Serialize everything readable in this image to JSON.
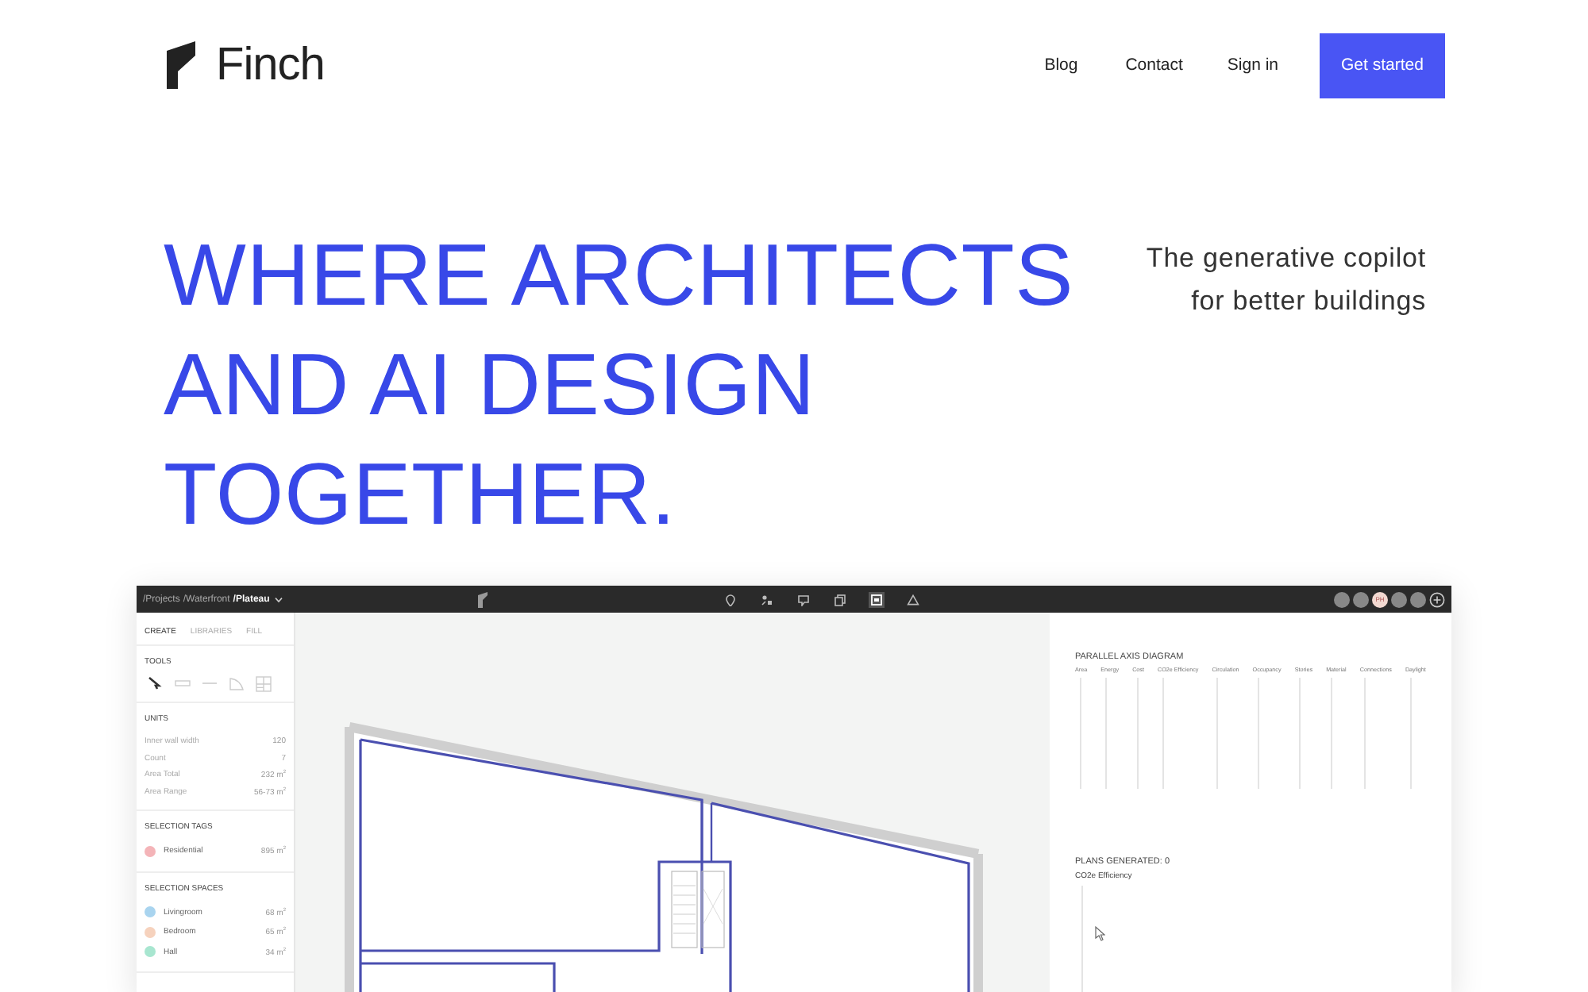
{
  "header": {
    "brand": "Finch",
    "nav": [
      {
        "label": "Blog"
      },
      {
        "label": "Contact"
      },
      {
        "label": "Sign in"
      }
    ],
    "cta": "Get started"
  },
  "hero": {
    "title_lines": [
      "WHERE ARCHITECTS",
      "AND AI DESIGN",
      "TOGETHER."
    ],
    "tagline_lines": [
      "The generative copilot",
      "for better buildings"
    ]
  },
  "app": {
    "breadcrumb": [
      {
        "label": "/Projects",
        "current": false
      },
      {
        "label": "/Waterfront",
        "current": false
      },
      {
        "label": "/Plateau",
        "current": true
      }
    ],
    "toolbar": [
      {
        "kind": "pin",
        "selected": false
      },
      {
        "kind": "shapes",
        "selected": false
      },
      {
        "kind": "comment",
        "selected": false
      },
      {
        "kind": "copy",
        "selected": false
      },
      {
        "kind": "image",
        "selected": true
      },
      {
        "kind": "triangle",
        "selected": false
      }
    ],
    "avatars": [
      {
        "kind": "photo"
      },
      {
        "kind": "photo"
      },
      {
        "kind": "initials",
        "initials": "PH"
      },
      {
        "kind": "photo"
      },
      {
        "kind": "photo"
      }
    ],
    "sidebar": {
      "tabs": [
        {
          "label": "CREATE",
          "selected": true
        },
        {
          "label": "LIBRARIES",
          "selected": false
        },
        {
          "label": "FILL",
          "selected": false
        }
      ],
      "tools_title": "TOOLS",
      "tools": [
        {
          "kind": "cursor",
          "selected": true
        },
        {
          "kind": "wall",
          "selected": false
        },
        {
          "kind": "line",
          "selected": false
        },
        {
          "kind": "curve",
          "selected": false
        },
        {
          "kind": "grid",
          "selected": false
        }
      ],
      "units_title": "UNITS",
      "units": [
        {
          "label": "Inner wall width",
          "value": "120"
        },
        {
          "label": "Count",
          "value": "7"
        },
        {
          "label": "Area Total",
          "value": "232 m$^{2}$"
        },
        {
          "label": "Area Range",
          "value": "56-73 m$^{2}$"
        }
      ],
      "tags_title": "SELECTION TAGS",
      "tags": [
        {
          "label": "Residential",
          "value": "895 m$^{2}$",
          "color": "#f4b4b8"
        }
      ],
      "spaces_title": "SELECTION SPACES",
      "spaces": [
        {
          "label": "Livingroom",
          "value": "68 m$^{2}$",
          "color": "#a9d4ef"
        },
        {
          "label": "Bedroom",
          "value": "65 m$^{2}$",
          "color": "#f6d2bd"
        },
        {
          "label": "Hall",
          "value": "34 m$^{2}$",
          "color": "#a8e6d0"
        }
      ]
    },
    "panel": {
      "diagram_title": "PARALLEL AXIS DIAGRAM",
      "axes": [
        {
          "label": "Area"
        },
        {
          "label": "Energy"
        },
        {
          "label": "Cost"
        },
        {
          "label": "CO2e Efficiency"
        },
        {
          "label": "Circulation"
        },
        {
          "label": "Occupancy"
        },
        {
          "label": "Stories"
        },
        {
          "label": "Material"
        },
        {
          "label": "Connections"
        },
        {
          "label": "Daylight"
        }
      ],
      "plans_generated": "PLANS GENERATED: 0",
      "metric": "CO2e Efficiency"
    }
  }
}
